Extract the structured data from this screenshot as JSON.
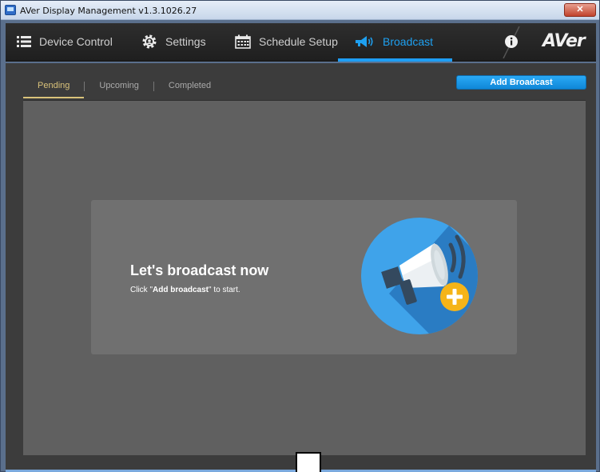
{
  "window": {
    "title": "AVer Display Management v1.3.1026.27",
    "close_glyph": "✕"
  },
  "nav": {
    "items": [
      {
        "label": "Device Control",
        "icon": "list-icon"
      },
      {
        "label": "Settings",
        "icon": "gear-icon"
      },
      {
        "label": "Schedule Setup",
        "icon": "calendar-icon"
      },
      {
        "label": "Broadcast",
        "icon": "megaphone-icon"
      }
    ],
    "active_index": 3,
    "info_icon": "info-icon",
    "brand": "AVer"
  },
  "tabs": [
    {
      "label": "Pending",
      "active": true
    },
    {
      "label": "Upcoming",
      "active": false
    },
    {
      "label": "Completed",
      "active": false
    }
  ],
  "add_broadcast_label": "Add Broadcast",
  "empty_state": {
    "title": "Let's broadcast now",
    "hint_prefix": "Click \"",
    "hint_bold": "Add broadcast",
    "hint_suffix": "\" to start.",
    "illustration": "megaphone-plus-icon"
  },
  "colors": {
    "accent": "#1ea0f0",
    "active_tab": "#d9c27a",
    "badge": "#f5b418"
  }
}
